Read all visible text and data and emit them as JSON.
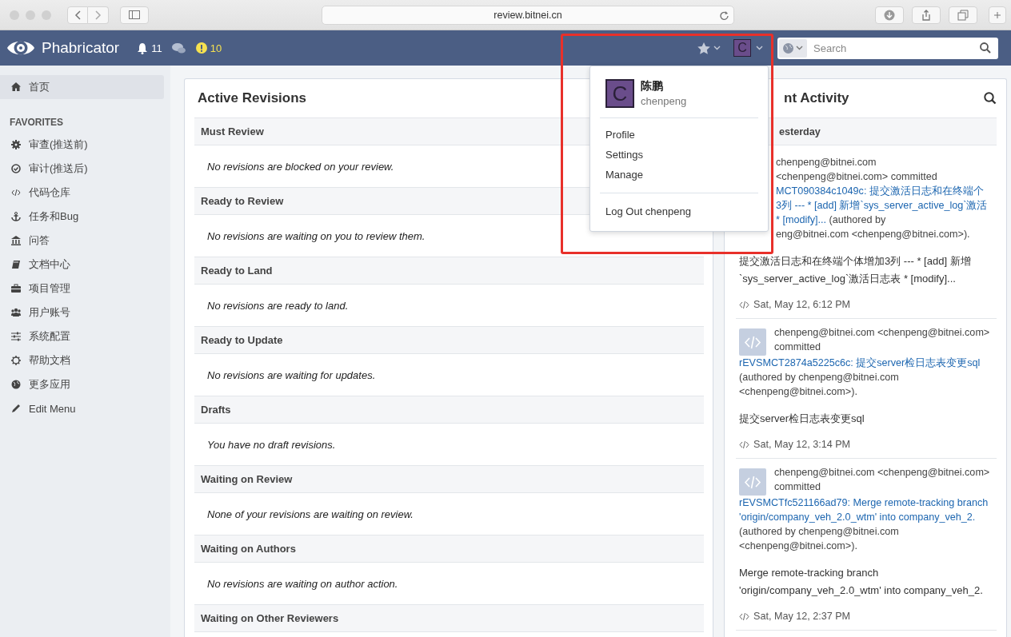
{
  "browser": {
    "url": "review.bitnei.cn"
  },
  "header": {
    "brand": "Phabricator",
    "notifications": "11",
    "alerts": "10",
    "avatar_letter": "C",
    "search": {
      "placeholder": "Search"
    }
  },
  "sidebar": {
    "items": [
      {
        "label": "首页",
        "selected": true
      }
    ],
    "section_title": "FAVORITES",
    "favorites": [
      {
        "label": "审查(推送前)",
        "selected": false
      },
      {
        "label": "审计(推送后)",
        "selected": false
      },
      {
        "label": "代码仓库",
        "selected": false
      },
      {
        "label": "任务和Bug",
        "selected": false
      },
      {
        "label": "问答",
        "selected": false
      },
      {
        "label": "文档中心",
        "selected": false
      },
      {
        "label": "项目管理",
        "selected": false
      },
      {
        "label": "用户账号",
        "selected": false
      },
      {
        "label": "系统配置",
        "selected": false
      },
      {
        "label": "帮助文档",
        "selected": false
      },
      {
        "label": "更多应用",
        "selected": false
      },
      {
        "label": "Edit Menu",
        "selected": false
      }
    ]
  },
  "revisions": {
    "title": "Active Revisions",
    "sections": [
      {
        "heading": "Must Review",
        "message": "No revisions are blocked on your review."
      },
      {
        "heading": "Ready to Review",
        "message": "No revisions are waiting on you to review them."
      },
      {
        "heading": "Ready to Land",
        "message": "No revisions are ready to land."
      },
      {
        "heading": "Ready to Update",
        "message": "No revisions are waiting for updates."
      },
      {
        "heading": "Drafts",
        "message": "You have no draft revisions."
      },
      {
        "heading": "Waiting on Review",
        "message": "None of your revisions are waiting on review."
      },
      {
        "heading": "Waiting on Authors",
        "message": "No revisions are waiting on author action."
      },
      {
        "heading": "Waiting on Other Reviewers"
      }
    ]
  },
  "activity": {
    "title": "nt Activity",
    "day": "esterday",
    "entries": [
      {
        "kind": "clipped",
        "lines": [
          {
            "parts": [
              {
                "text": "chenpeng@bitnei.com",
                "link": false
              }
            ]
          },
          {
            "parts": [
              {
                "text": "<chenpeng@bitnei.com> committed",
                "link": false
              }
            ]
          },
          {
            "parts": [
              {
                "text": "MCT090384c1049c: 提交激活日志和在终端个",
                "link": true
              }
            ]
          },
          {
            "parts": [
              {
                "text": "3列 --- * [add] 新增`sys_server_active_log`激活",
                "link": true
              }
            ]
          },
          {
            "parts": [
              {
                "text": "* [modify]...",
                "link": true
              },
              {
                "text": " (authored by",
                "link": false
              }
            ]
          },
          {
            "parts": [
              {
                "text": "eng@bitnei.com <chenpeng@bitnei.com>).",
                "link": false
              }
            ]
          }
        ],
        "message": "提交激活日志和在终端个体增加3列 --- * [add] 新增`sys_server_active_log`激活日志表 * [modify]...",
        "time": "Sat, May 12, 6:12 PM"
      },
      {
        "kind": "full",
        "author": "chenpeng@bitnei.com <chenpeng@bitnei.com> committed",
        "link": "rEVSMCT2874a5225c6c: 提交server检日志表变更sql",
        "tail": "(authored by chenpeng@bitnei.com <chenpeng@bitnei.com>).",
        "message": "提交server检日志表变更sql",
        "time": "Sat, May 12, 3:14 PM"
      },
      {
        "kind": "full",
        "author": "chenpeng@bitnei.com <chenpeng@bitnei.com> committed",
        "link": "rEVSMCTfc521166ad79: Merge remote-tracking branch 'origin/company_veh_2.0_wtm' into company_veh_2.",
        "tail": "(authored by chenpeng@bitnei.com <chenpeng@bitnei.com>).",
        "message": "Merge remote-tracking branch 'origin/company_veh_2.0_wtm' into company_veh_2.",
        "time": "Sat, May 12, 2:37 PM"
      }
    ]
  },
  "user_menu": {
    "avatar_letter": "C",
    "display_name": "陈鹏",
    "username": "chenpeng",
    "items": [
      "Profile",
      "Settings",
      "Manage"
    ],
    "logout": "Log Out chenpeng"
  }
}
